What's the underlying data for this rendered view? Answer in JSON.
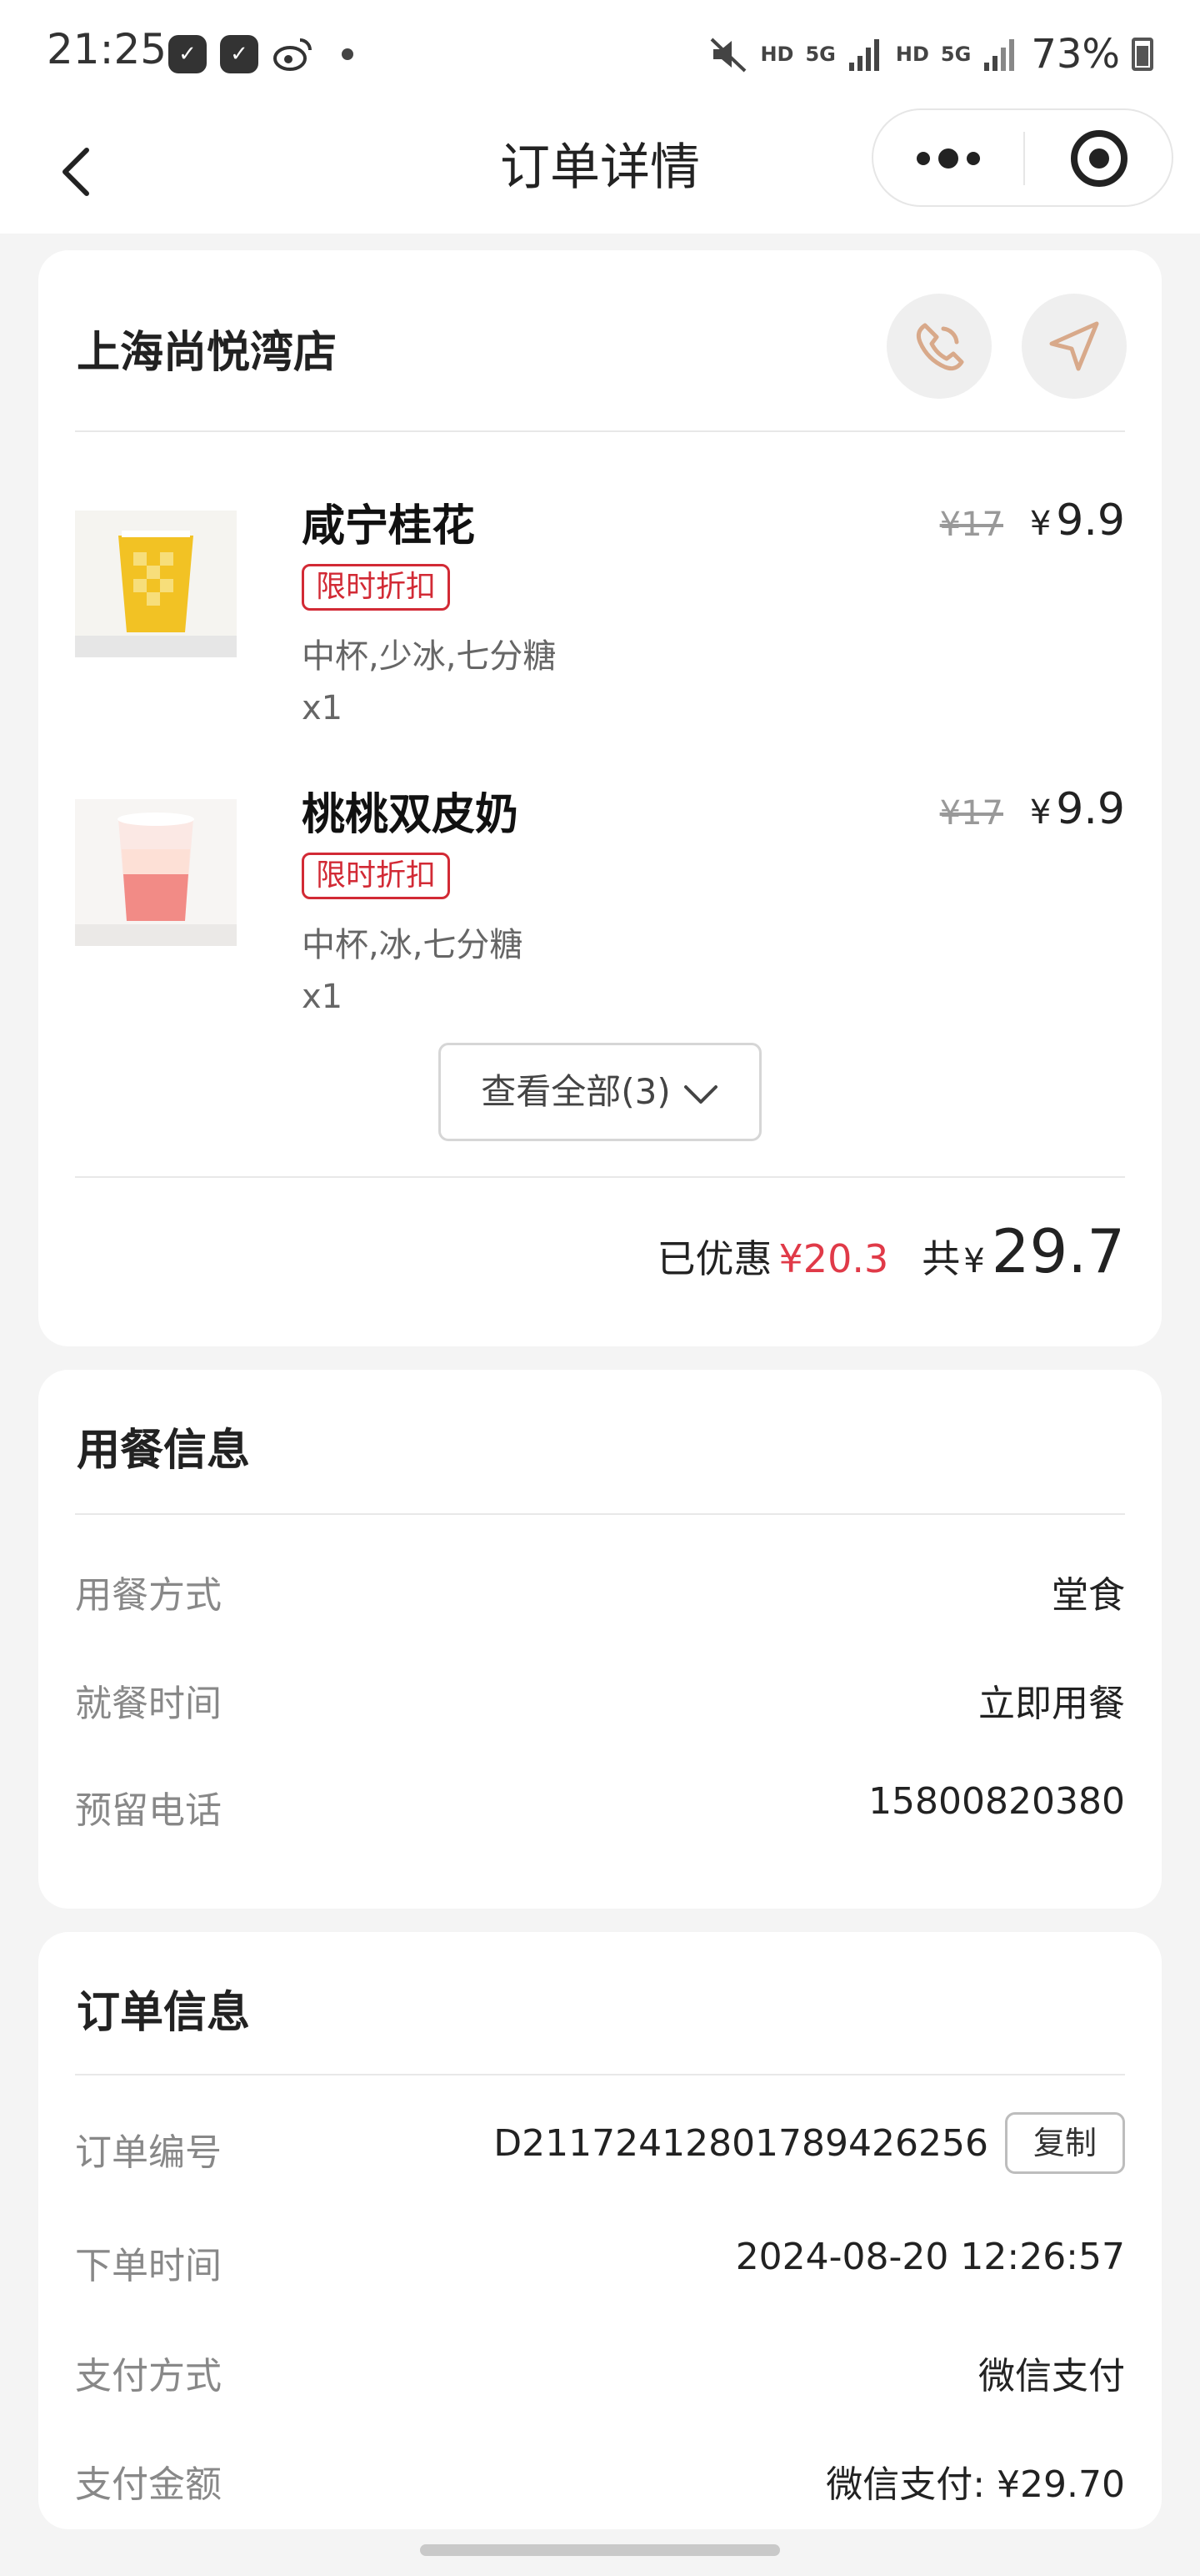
{
  "status_bar": {
    "time": "21:25",
    "network_1": "HD",
    "network_2": "5G",
    "network_3": "HD",
    "network_4": "5G",
    "battery": "73%"
  },
  "nav": {
    "title": "订单详情"
  },
  "store": {
    "name": "上海尚悦湾店"
  },
  "items": [
    {
      "name": "咸宁桂花",
      "badge": "限时折扣",
      "spec": "中杯,少冰,七分糖",
      "qty": "x1",
      "price_old": "¥17",
      "price_currency": "¥",
      "price_now": "9.9"
    },
    {
      "name": "桃桃双皮奶",
      "badge": "限时折扣",
      "spec": "中杯,冰,七分糖",
      "qty": "x1",
      "price_old": "¥17",
      "price_currency": "¥",
      "price_now": "9.9"
    }
  ],
  "view_all_label": "查看全部(3)",
  "summary": {
    "discount_label": "已优惠",
    "discount_value": "¥20.3",
    "total_label": "共",
    "total_currency": "¥",
    "total_value": "29.7"
  },
  "dining": {
    "title": "用餐信息",
    "rows": [
      {
        "label": "用餐方式",
        "value": "堂食"
      },
      {
        "label": "就餐时间",
        "value": "立即用餐"
      },
      {
        "label": "预留电话",
        "value": "15800820380"
      }
    ]
  },
  "order": {
    "title": "订单信息",
    "copy_label": "复制",
    "rows": [
      {
        "label": "订单编号",
        "value": "D21172412801789426256"
      },
      {
        "label": "下单时间",
        "value": "2024-08-20 12:26:57"
      },
      {
        "label": "支付方式",
        "value": "微信支付"
      },
      {
        "label": "支付金额",
        "value": "微信支付: ¥29.70"
      }
    ]
  },
  "colors": {
    "accent_red": "#d22a35",
    "discount_red": "#e03a48",
    "icon_tan": "#d8a98a"
  }
}
